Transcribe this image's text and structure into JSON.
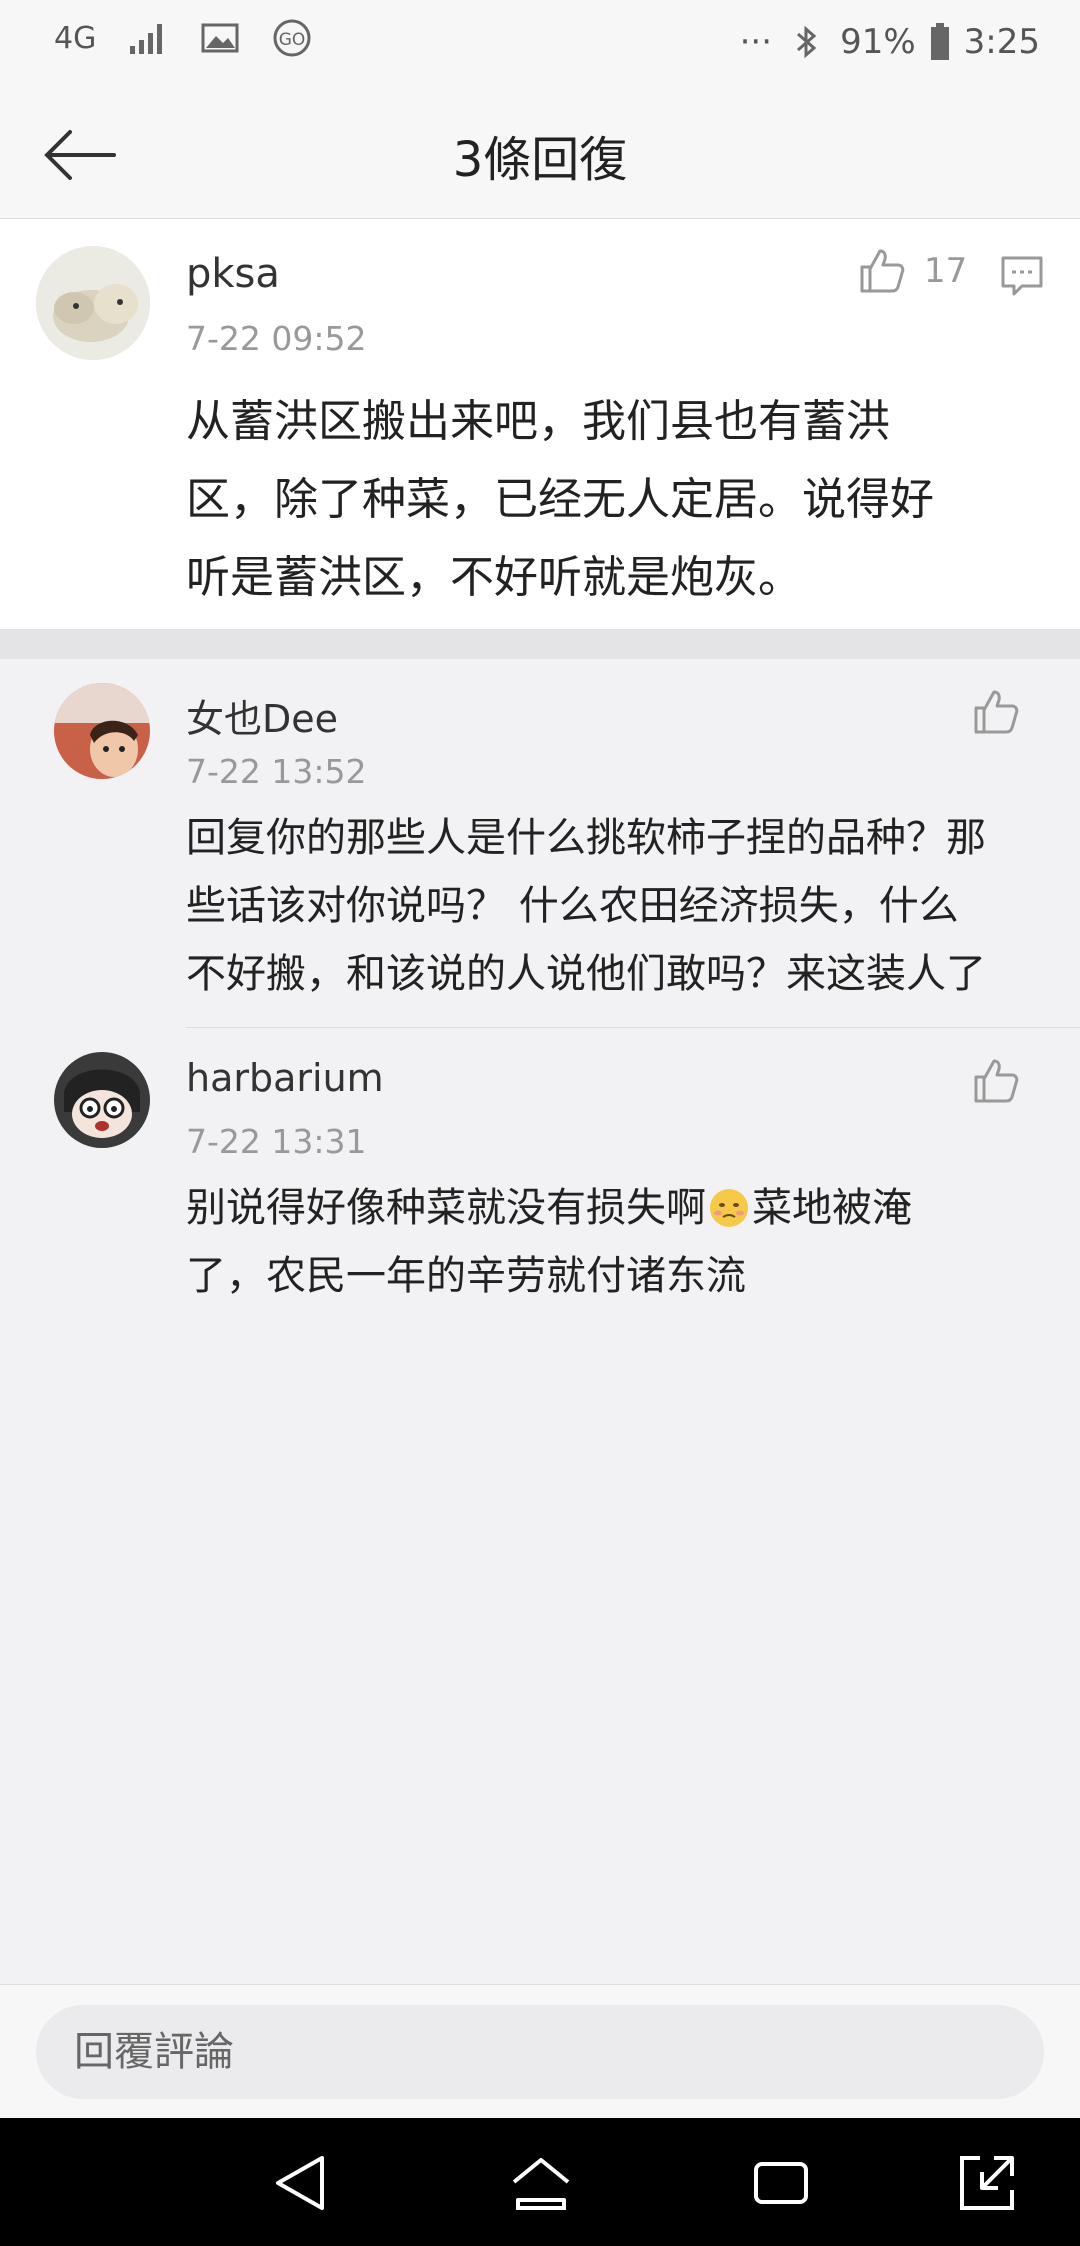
{
  "status_bar": {
    "network": "4G",
    "go_badge": "GO",
    "overflow": "···",
    "battery": "91%",
    "time": "3:25",
    "icons": [
      "signal-icon",
      "image-icon",
      "go-icon",
      "bluetooth-icon",
      "battery-icon"
    ]
  },
  "header": {
    "title": "3條回復",
    "back_icon": "arrow-left-icon"
  },
  "main_comment": {
    "user": "pksa",
    "time": "7-22 09:52",
    "likes": "17",
    "lines": [
      "从蓄洪区搬出来吧，我们县也有蓄洪",
      "区，除了种菜，已经无人定居。说得好",
      "听是蓄洪区，不好听就是炮灰。"
    ]
  },
  "replies": [
    {
      "user": "女也Dee",
      "time": "7-22 13:52",
      "lines": [
        "回复你的那些人是什么挑软柿子捏的品种？那",
        "些话该对你说吗？ 什么农田经济损失，什么",
        "不好搬，和该说的人说他们敢吗？来这装人了"
      ]
    },
    {
      "user": "harbarium",
      "time": "7-22 13:31",
      "lines": [
        "别说得好像种菜就没有损失啊",
        "菜地被淹",
        "了，农民一年的辛劳就付诸东流"
      ]
    }
  ],
  "reply_bar": {
    "placeholder": "回覆評論"
  },
  "nav_bar": {
    "icons": [
      "back-triangle-icon",
      "home-icon",
      "recents-icon",
      "expand-icon"
    ]
  }
}
